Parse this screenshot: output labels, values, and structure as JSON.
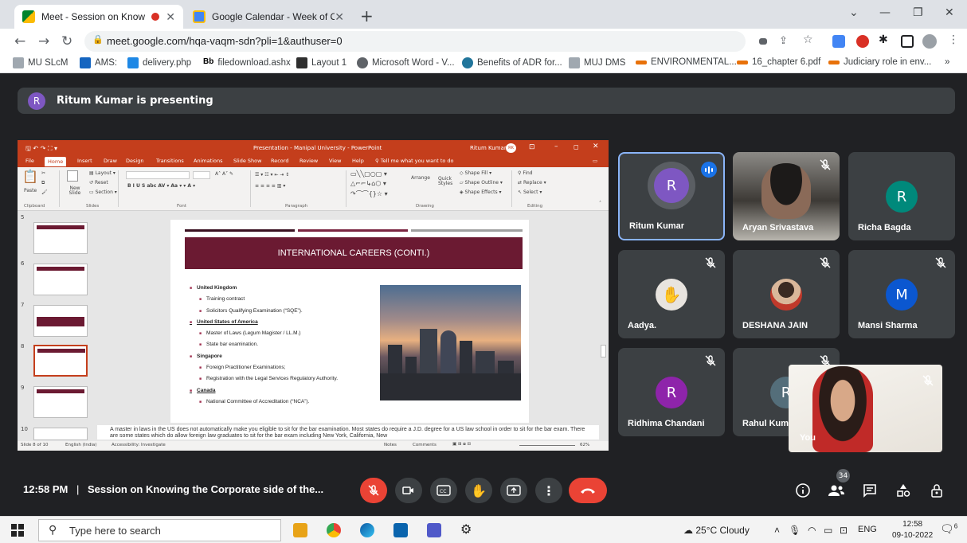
{
  "browser": {
    "tabs": [
      {
        "title": "Meet - Session on Knowing t",
        "active": true
      },
      {
        "title": "Google Calendar - Week of Octo",
        "active": false
      }
    ],
    "url": "meet.google.com/hqa-vaqm-sdn?pli=1&authuser=0",
    "bookmarks": [
      "MU SLcM",
      "AMS:",
      "delivery.php",
      "filedownload.ashx",
      "Layout 1",
      "Microsoft Word - V...",
      "Benefits of ADR for...",
      "MUJ DMS",
      "ENVIRONMENTAL...",
      "16_chapter 6.pdf",
      "Judiciary role in env..."
    ]
  },
  "meet": {
    "presenting_text": "Ritum Kumar is presenting",
    "presenter_initial": "R",
    "time": "12:58 PM",
    "separator": "|",
    "meeting_title": "Session on Knowing the Corporate side of the...",
    "participant_count": "34",
    "self_label": "You",
    "participants": [
      {
        "name": "Ritum Kumar",
        "initial": "R",
        "color": "#7e57c2",
        "speaking": true
      },
      {
        "name": "Aryan Srivastava",
        "initial": "",
        "color": "",
        "muted": true,
        "video": true
      },
      {
        "name": "Richa Bagda",
        "initial": "R",
        "color": "#00897b"
      },
      {
        "name": "Aadya.",
        "initial": "",
        "color": "#d0ccc8",
        "muted": true
      },
      {
        "name": "DESHANA JAIN",
        "initial": "",
        "color": "#c0392b",
        "muted": true
      },
      {
        "name": "Mansi Sharma",
        "initial": "M",
        "color": "#0b57d0",
        "muted": true
      },
      {
        "name": "Ridhima Chandani",
        "initial": "R",
        "color": "#8e24aa",
        "muted": true
      },
      {
        "name": "Rahul Kum",
        "initial": "R",
        "color": "#546e7a",
        "muted": true
      }
    ]
  },
  "ppt": {
    "title_bar": "Presentation - Manipal University - PowerPoint",
    "user": "Ritum Kumar",
    "user_initials": "RK",
    "tabs": [
      "File",
      "Home",
      "Insert",
      "Draw",
      "Design",
      "Transitions",
      "Animations",
      "Slide Show",
      "Record",
      "Review",
      "View",
      "Help",
      "Tell me what you want to do"
    ],
    "groups": [
      "Clipboard",
      "Slides",
      "Font",
      "Paragraph",
      "Drawing",
      "Editing"
    ],
    "ribbon": {
      "paste": "Paste",
      "new_slide": "New Slide",
      "layout": "Layout",
      "reset": "Reset",
      "section": "Section",
      "find": "Find",
      "replace": "Replace",
      "select": "Select",
      "shape_fill": "Shape Fill",
      "shape_outline": "Shape Outline",
      "shape_effects": "Shape Effects",
      "arrange": "Arrange",
      "quick_styles": "Quick Styles"
    },
    "slide_numbers": [
      "5",
      "6",
      "7",
      "8",
      "9",
      "10"
    ],
    "slide": {
      "title": "INTERNATIONAL CAREERS (CONTI.)",
      "items": [
        {
          "level": 1,
          "text": "United Kingdom"
        },
        {
          "level": 2,
          "text": "Training contract"
        },
        {
          "level": 2,
          "text": "Solicitors Qualifying Examination (“SQE”)."
        },
        {
          "level": 1,
          "text": "United States of America",
          "underline": true
        },
        {
          "level": 2,
          "text": "Master of Laws (Legum Magister / LL.M.)"
        },
        {
          "level": 2,
          "text": "State bar examination."
        },
        {
          "level": 1,
          "text": "Singapore"
        },
        {
          "level": 2,
          "text": "Foreign Practitioner Examinations;"
        },
        {
          "level": 2,
          "text": "Registration with the Legal Services Regulatory Authority."
        },
        {
          "level": 1,
          "text": "Canada",
          "underline": true
        },
        {
          "level": 2,
          "text": "National Committee of Accreditation (“NCA”)."
        }
      ]
    },
    "notes": "A master in laws in the US does not automatically make you eligible to sit for the bar examination. Most states do require a J.D. degree for a US law school in order to sit for the bar exam. There are some states which do allow foreign law graduates to sit for the bar exam including New York, California, New",
    "status": {
      "slide": "Slide 8 of 10",
      "language": "English (India)",
      "accessibility": "Accessibility: Investigate",
      "notes": "Notes",
      "comments": "Comments",
      "zoom": "62%"
    }
  },
  "taskbar": {
    "search_placeholder": "Type here to search",
    "weather": "25°C  Cloudy",
    "lang": "ENG",
    "time": "12:58",
    "date": "09-10-2022",
    "notif": "6"
  },
  "colors": {
    "meet_bg": "#202124",
    "tile_bg": "#3c4043",
    "end_call": "#ea4335",
    "ppt_red": "#c43e1c",
    "slide_maroon": "#6b1a32"
  }
}
